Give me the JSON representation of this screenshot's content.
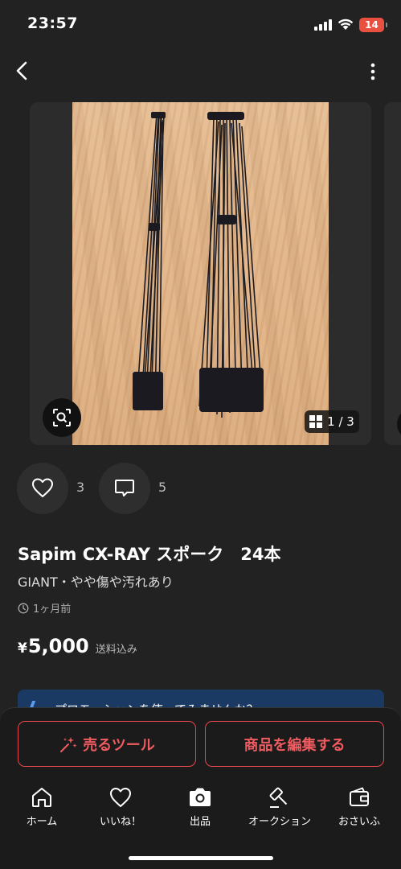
{
  "status_bar": {
    "time": "23:57",
    "battery": "14"
  },
  "gallery": {
    "counter": "1 / 3"
  },
  "engagement": {
    "likes": "3",
    "comments": "5"
  },
  "item": {
    "title": "Sapim CX-RAY スポーク　24本",
    "subtitle": "GIANT・やや傷や汚れあり",
    "posted": "1ヶ月前",
    "price_symbol": "¥",
    "price": "5,000",
    "shipping": "送料込み"
  },
  "promo": {
    "text": "プロモーションを使ってみませんか？"
  },
  "actions": {
    "sell_tool": "売るツール",
    "edit_item": "商品を編集する"
  },
  "tabs": [
    "ホーム",
    "いいね！",
    "出品",
    "オークション",
    "おさいふ"
  ],
  "colors": {
    "accent": "#e5484d",
    "background": "#222222",
    "promo": "#1b3a63"
  }
}
